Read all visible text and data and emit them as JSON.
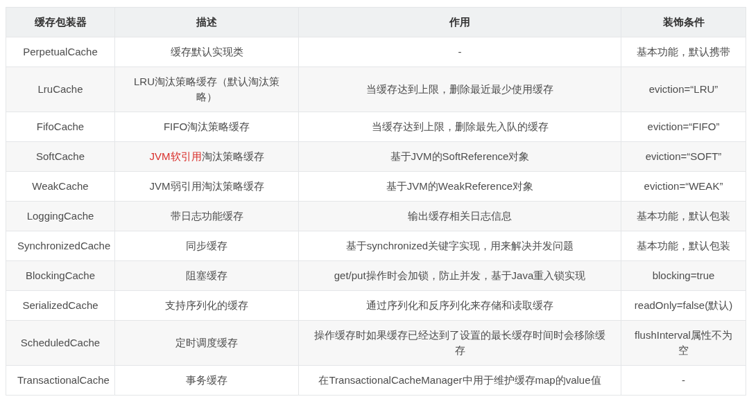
{
  "table": {
    "columns": [
      "缓存包装器",
      "描述",
      "作用",
      "装饰条件"
    ],
    "rows": [
      {
        "cells": [
          "PerpetualCache",
          [
            {
              "text": "缓存默认实现类"
            }
          ],
          "-",
          "基本功能，默认携带"
        ]
      },
      {
        "cells": [
          "LruCache",
          [
            {
              "text": "LRU淘汰策略缓存（默认淘汰策略）"
            }
          ],
          "当缓存达到上限，删除最近最少使用缓存",
          "eviction=“LRU”"
        ]
      },
      {
        "cells": [
          "FifoCache",
          [
            {
              "text": "FIFO淘汰策略缓存"
            }
          ],
          "当缓存达到上限，删除最先入队的缓存",
          "eviction=“FIFO”"
        ]
      },
      {
        "cells": [
          "SoftCache",
          [
            {
              "text": "JVM软引用",
              "color": "#d9302c"
            },
            {
              "text": "淘汰策略缓存"
            }
          ],
          "基于JVM的SoftReference对象",
          "eviction=“SOFT”"
        ]
      },
      {
        "cells": [
          "WeakCache",
          [
            {
              "text": "JVM弱引用淘汰策略缓存"
            }
          ],
          "基于JVM的WeakReference对象",
          "eviction=“WEAK”"
        ]
      },
      {
        "cells": [
          "LoggingCache",
          [
            {
              "text": "带日志功能缓存"
            }
          ],
          "输出缓存相关日志信息",
          "基本功能，默认包装"
        ]
      },
      {
        "cells": [
          "SynchronizedCache",
          [
            {
              "text": "同步缓存"
            }
          ],
          "基于synchronized关键字实现，用来解决并发问题",
          "基本功能，默认包装"
        ]
      },
      {
        "cells": [
          "BlockingCache",
          [
            {
              "text": "阻塞缓存"
            }
          ],
          "get/put操作时会加锁，防止并发，基于Java重入锁实现",
          "blocking=true"
        ]
      },
      {
        "cells": [
          "SerializedCache",
          [
            {
              "text": "支持序列化的缓存"
            }
          ],
          "通过序列化和反序列化来存储和读取缓存",
          "readOnly=false(默认)"
        ]
      },
      {
        "cells": [
          "ScheduledCache",
          [
            {
              "text": "定时调度缓存"
            }
          ],
          "操作缓存时如果缓存已经达到了设置的最长缓存时间时会移除缓存",
          "flushInterval属性不为空"
        ]
      },
      {
        "cells": [
          "TransactionalCache",
          [
            {
              "text": "事务缓存"
            }
          ],
          "在TransactionalCacheManager中用于维护缓存map的value值",
          "-"
        ]
      }
    ]
  }
}
